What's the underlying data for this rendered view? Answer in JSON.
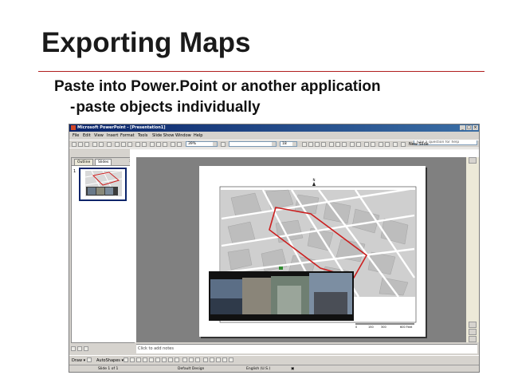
{
  "slide": {
    "title": "Exporting Maps",
    "bullet": "Paste into Power.Point or another application",
    "sub_bullet_dash": "-",
    "sub_bullet": "paste objects individually",
    "accent_color": "#b01e1e"
  },
  "window": {
    "title": "Microsoft PowerPoint - [Presentation1]",
    "controls": [
      "_",
      "□",
      "×"
    ]
  },
  "menu": {
    "items": [
      "File",
      "Edit",
      "View",
      "Insert",
      "Format",
      "Tools",
      "Slide Show",
      "Window",
      "Help"
    ],
    "help_placeholder": "Type a question for help"
  },
  "toolbar": {
    "zoom": "39%",
    "font_size": "18",
    "new_slide": "New Slide"
  },
  "panel": {
    "tabs": [
      "Outline",
      "Slides"
    ],
    "close": "×",
    "slide_number": "1"
  },
  "notes": {
    "placeholder": "Click to add notes"
  },
  "drawing": {
    "draw_label": "Draw ▾",
    "autoshapes_label": "AutoShapes ▾"
  },
  "status": {
    "slide": "Slide 1 of 1",
    "design": "Default Design",
    "language": "English (U.S.)"
  },
  "map": {
    "scale_labels": [
      "0",
      "150",
      "300",
      "600 Feet"
    ],
    "north_label": "N",
    "route_color": "#cc1f1f"
  }
}
